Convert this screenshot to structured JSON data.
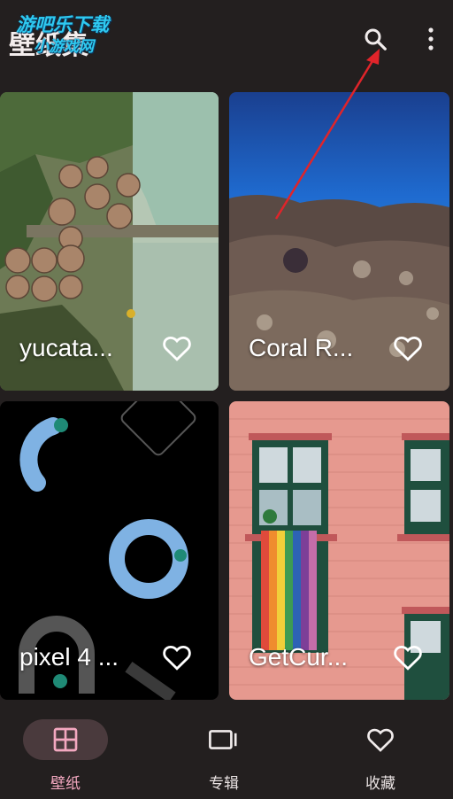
{
  "header": {
    "title": "壁纸集",
    "watermark_line1": "游吧乐下载",
    "watermark_line2": "小游戏网",
    "search_icon": "search-icon",
    "more_icon": "more-vert-icon"
  },
  "wallpapers": [
    {
      "label": "yucata...",
      "favorite_icon": "heart-outline-icon"
    },
    {
      "label": "Coral R...",
      "favorite_icon": "heart-outline-icon"
    },
    {
      "label": "pixel 4 ...",
      "favorite_icon": "heart-outline-icon"
    },
    {
      "label": "GetCur...",
      "favorite_icon": "heart-outline-icon"
    }
  ],
  "bottom_nav": {
    "items": [
      {
        "label": "壁纸",
        "icon": "grid-icon",
        "active": true
      },
      {
        "label": "专辑",
        "icon": "album-icon",
        "active": false
      },
      {
        "label": "收藏",
        "icon": "heart-outline-icon",
        "active": false
      }
    ]
  },
  "colors": {
    "background": "#231f1f",
    "accent": "#f3a8c0",
    "nav_active_pill": "#4a3a3d",
    "annotation_arrow": "#e0242a"
  }
}
